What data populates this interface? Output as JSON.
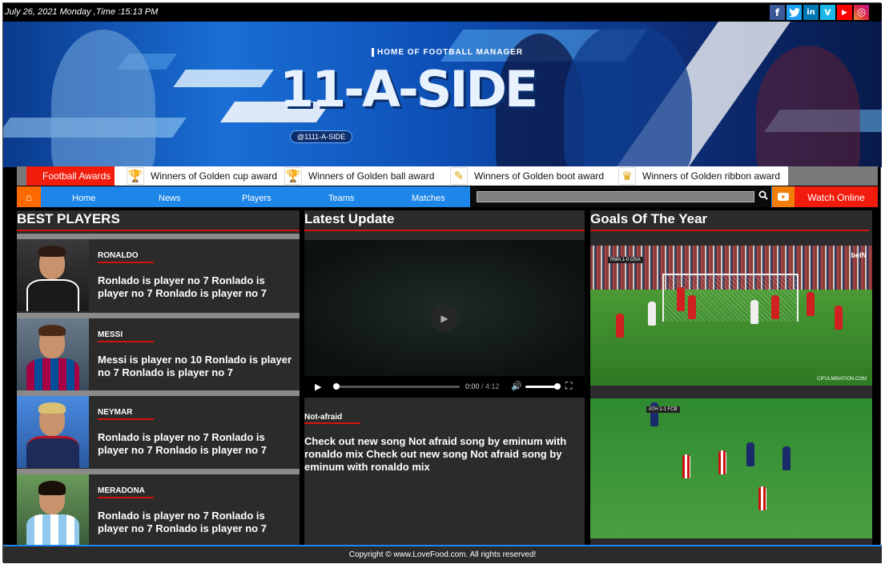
{
  "topbar": {
    "datetime": "July 26, 2021 Monday ,Time :15:13 PM",
    "socials": [
      {
        "icon": "facebook-icon",
        "glyph": "f",
        "color": "#3b5998"
      },
      {
        "icon": "twitter-icon",
        "glyph": "t",
        "color": "#1da1f2"
      },
      {
        "icon": "linkedin-icon",
        "glyph": "in",
        "color": "#0077b5"
      },
      {
        "icon": "vimeo-icon",
        "glyph": "v",
        "color": "#1ab7ea"
      },
      {
        "icon": "youtube-icon",
        "glyph": "▶",
        "color": "#ff0000"
      },
      {
        "icon": "instagram-icon",
        "glyph": "◎",
        "color": "#c13584"
      }
    ]
  },
  "banner": {
    "subtitle": "HOME OF FOOTBALL MANAGER",
    "logo": "11-A-SIDE",
    "handle": "@1111-A-SIDE"
  },
  "awards": {
    "label": "Football Awards",
    "items": [
      {
        "label": "Winners of Golden cup award",
        "icon": "trophy-icon"
      },
      {
        "label": "Winners of Golden ball award",
        "icon": "ball-trophy-icon"
      },
      {
        "label": "Winners of Golden boot award",
        "icon": "boot-icon"
      },
      {
        "label": "Winners of Golden ribbon award",
        "icon": "ribbon-icon"
      }
    ]
  },
  "nav": {
    "home_icon": "⌂",
    "items": [
      "Home",
      "News",
      "Players",
      "Teams",
      "Matches"
    ],
    "search_placeholder": "",
    "search_icon": "search-icon",
    "watch_label": "Watch Online"
  },
  "best_players": {
    "title": "BEST PLAYERS",
    "players": [
      {
        "name": "RONALDO",
        "desc": "Ronlado is player no 7 Ronlado is player no 7 Ronlado is player no 7"
      },
      {
        "name": "MESSI",
        "desc": "Messi is player no 10 Ronlado is player no 7 Ronlado is player no 7"
      },
      {
        "name": "NEYMAR",
        "desc": "Ronlado is player no 7 Ronlado is player no 7 Ronlado is player no 7"
      },
      {
        "name": "MERADONA",
        "desc": "Ronlado is player no 7 Ronlado is player no 7 Ronlado is player no 7"
      }
    ]
  },
  "latest": {
    "title": "Latest Update",
    "video": {
      "current": "0:00",
      "separator": " / ",
      "total": "4:12"
    },
    "tag": "Not-afraid",
    "text": "Check out new song Not afraid song by eminum with ronaldo mix Check out new song Not afraid song by eminum with ronaldo mix"
  },
  "goals": {
    "title": "Goals Of The Year",
    "clips": [
      {
        "scorebug": "RMA 1-0 OSA",
        "badge": "beIN",
        "watermark": "CIFULMINATION.COM"
      },
      {
        "scorebug": "ATH 1-1 FCB",
        "badge": "",
        "watermark": ""
      }
    ]
  },
  "footer": {
    "text": "Copyright © www.LoveFood.com. All rights reserved!"
  }
}
